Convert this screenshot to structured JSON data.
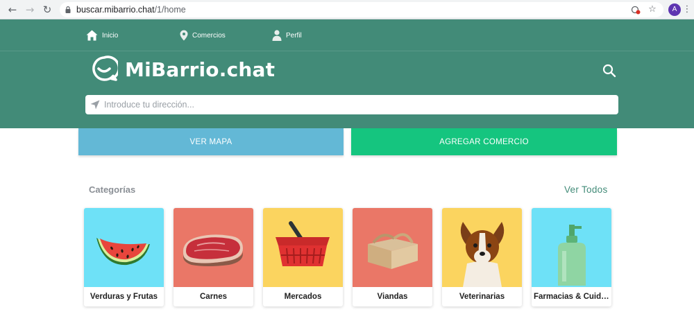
{
  "browser": {
    "url_host": "buscar.mibarrio.chat",
    "url_path": "/1/home",
    "avatar_letter": "A"
  },
  "nav": {
    "items": [
      {
        "label": "Inicio",
        "icon": "home-icon"
      },
      {
        "label": "Comercios",
        "icon": "location-pin-icon"
      },
      {
        "label": "Perfil",
        "icon": "person-icon"
      }
    ]
  },
  "brand": {
    "name": "MiBarrio.chat"
  },
  "search": {
    "placeholder": "Introduce tu dirección..."
  },
  "actions": {
    "map_label": "VER MAPA",
    "add_label": "AGREGAR COMERCIO"
  },
  "categories": {
    "title": "Categorías",
    "see_all": "Ver Todos",
    "items": [
      {
        "label": "Verduras y Frutas",
        "icon": "watermelon-icon",
        "bg": "#6ee1f7"
      },
      {
        "label": "Carnes",
        "icon": "steak-icon",
        "bg": "#ea7767"
      },
      {
        "label": "Mercados",
        "icon": "basket-icon",
        "bg": "#fbd45f"
      },
      {
        "label": "Viandas",
        "icon": "box-icon",
        "bg": "#ea7767"
      },
      {
        "label": "Veterinarias",
        "icon": "dog-icon",
        "bg": "#fbd45f"
      },
      {
        "label": "Farmacias & Cuidado",
        "icon": "pump-bottle-icon",
        "bg": "#6ee1f7"
      }
    ]
  },
  "colors": {
    "header": "#428b78",
    "map_button": "#63b8d6",
    "add_button": "#15c57f"
  }
}
